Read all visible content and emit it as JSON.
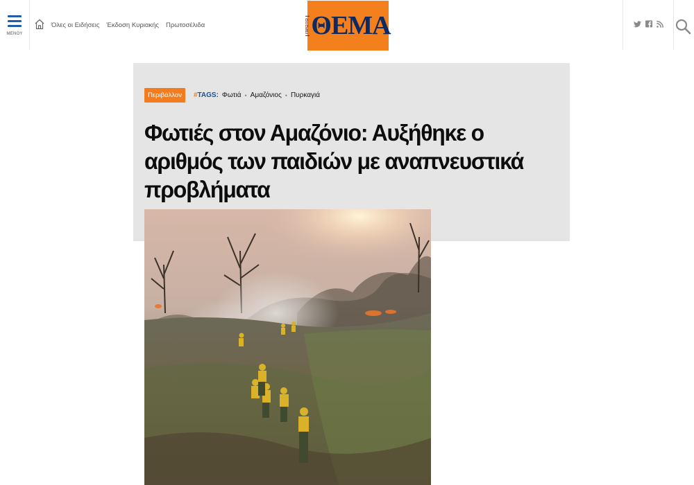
{
  "header": {
    "menu_label": "ΜΕΝΟΥ",
    "nav": [
      "Όλες οι Ειδήσεις",
      "Έκδοση Κυριακής",
      "Πρωτοσέλιδα"
    ],
    "logo": {
      "small": "ΠΡΩΤΟ",
      "main": "ΘΕΜΑ"
    },
    "social": [
      "twitter-icon",
      "facebook-icon",
      "rss-icon"
    ]
  },
  "article": {
    "category": "Περιβάλλον",
    "tags_label": "TAGS:",
    "tags": [
      "Φωτιά",
      "Αμαζόνιος",
      "Πυρκαγιά"
    ],
    "title": "Φωτιές στον Αμαζόνιο: Αυξήθηκε ο αριθμός των παιδιών με αναπνευστικά προβλήματα"
  },
  "colors": {
    "accent": "#f27c20",
    "logo_bg": "#f47f1d",
    "logo_text": "#0e2a63",
    "menu_blue": "#1d5fa8",
    "headline_bg": "#e6e5e6"
  }
}
